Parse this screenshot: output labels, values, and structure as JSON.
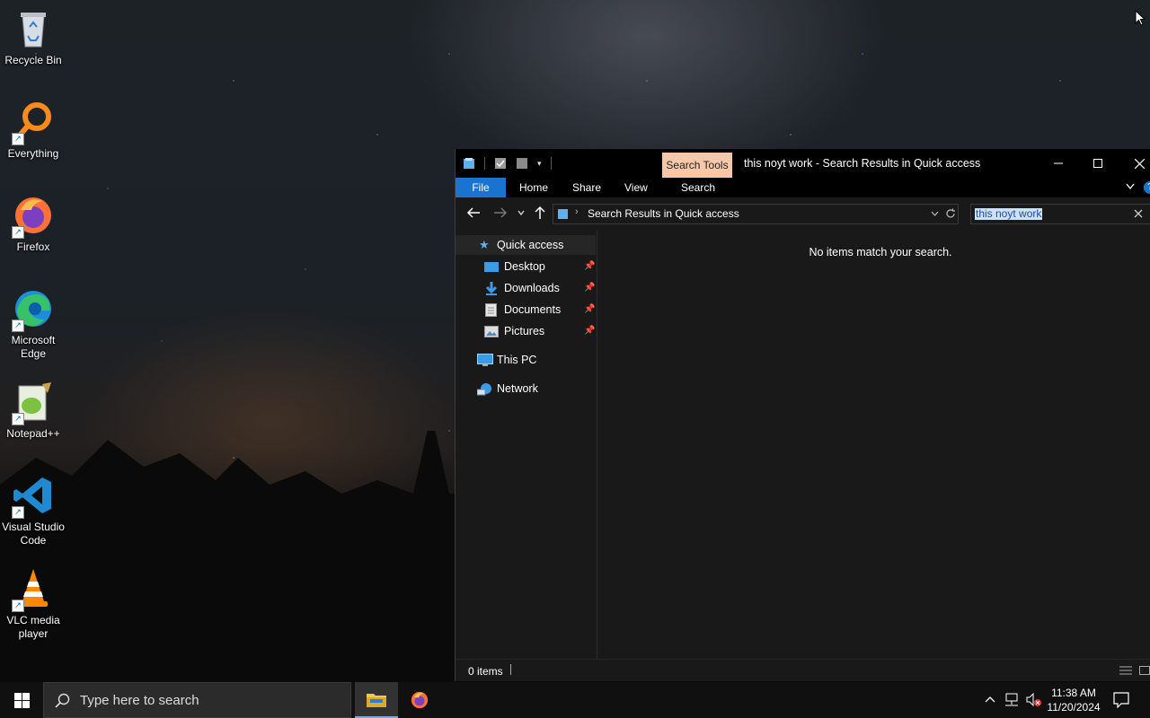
{
  "desktop": {
    "icons": [
      {
        "label": "Recycle Bin",
        "icon": "recycle-bin-icon"
      },
      {
        "label": "Everything",
        "icon": "everything-search-icon"
      },
      {
        "label": "Firefox",
        "icon": "firefox-icon"
      },
      {
        "label": "Microsoft Edge",
        "icon": "edge-icon"
      },
      {
        "label": "Notepad++",
        "icon": "notepad-plus-plus-icon"
      },
      {
        "label": "Visual Studio Code",
        "icon": "vscode-icon"
      },
      {
        "label": "VLC media player",
        "icon": "vlc-icon"
      }
    ]
  },
  "explorer": {
    "title": "this noyt work - Search Results in Quick access",
    "contextual_tab": "Search Tools",
    "ribbon_tabs": [
      "File",
      "Home",
      "Share",
      "View",
      "Search"
    ],
    "address": "Search Results in Quick access",
    "search_value": "this noyt work",
    "nav": {
      "quick_access": "Quick access",
      "pinned": [
        "Desktop",
        "Downloads",
        "Documents",
        "Pictures"
      ],
      "this_pc": "This PC",
      "network": "Network"
    },
    "empty_message": "No items match your search.",
    "status": "0 items"
  },
  "taskbar": {
    "search_placeholder": "Type here to search",
    "time": "11:38 AM",
    "date": "11/20/2024"
  },
  "colors": {
    "accent": "#1a73d0",
    "search_tools_tab": "#f8c8a8",
    "window_bg": "#191919"
  }
}
